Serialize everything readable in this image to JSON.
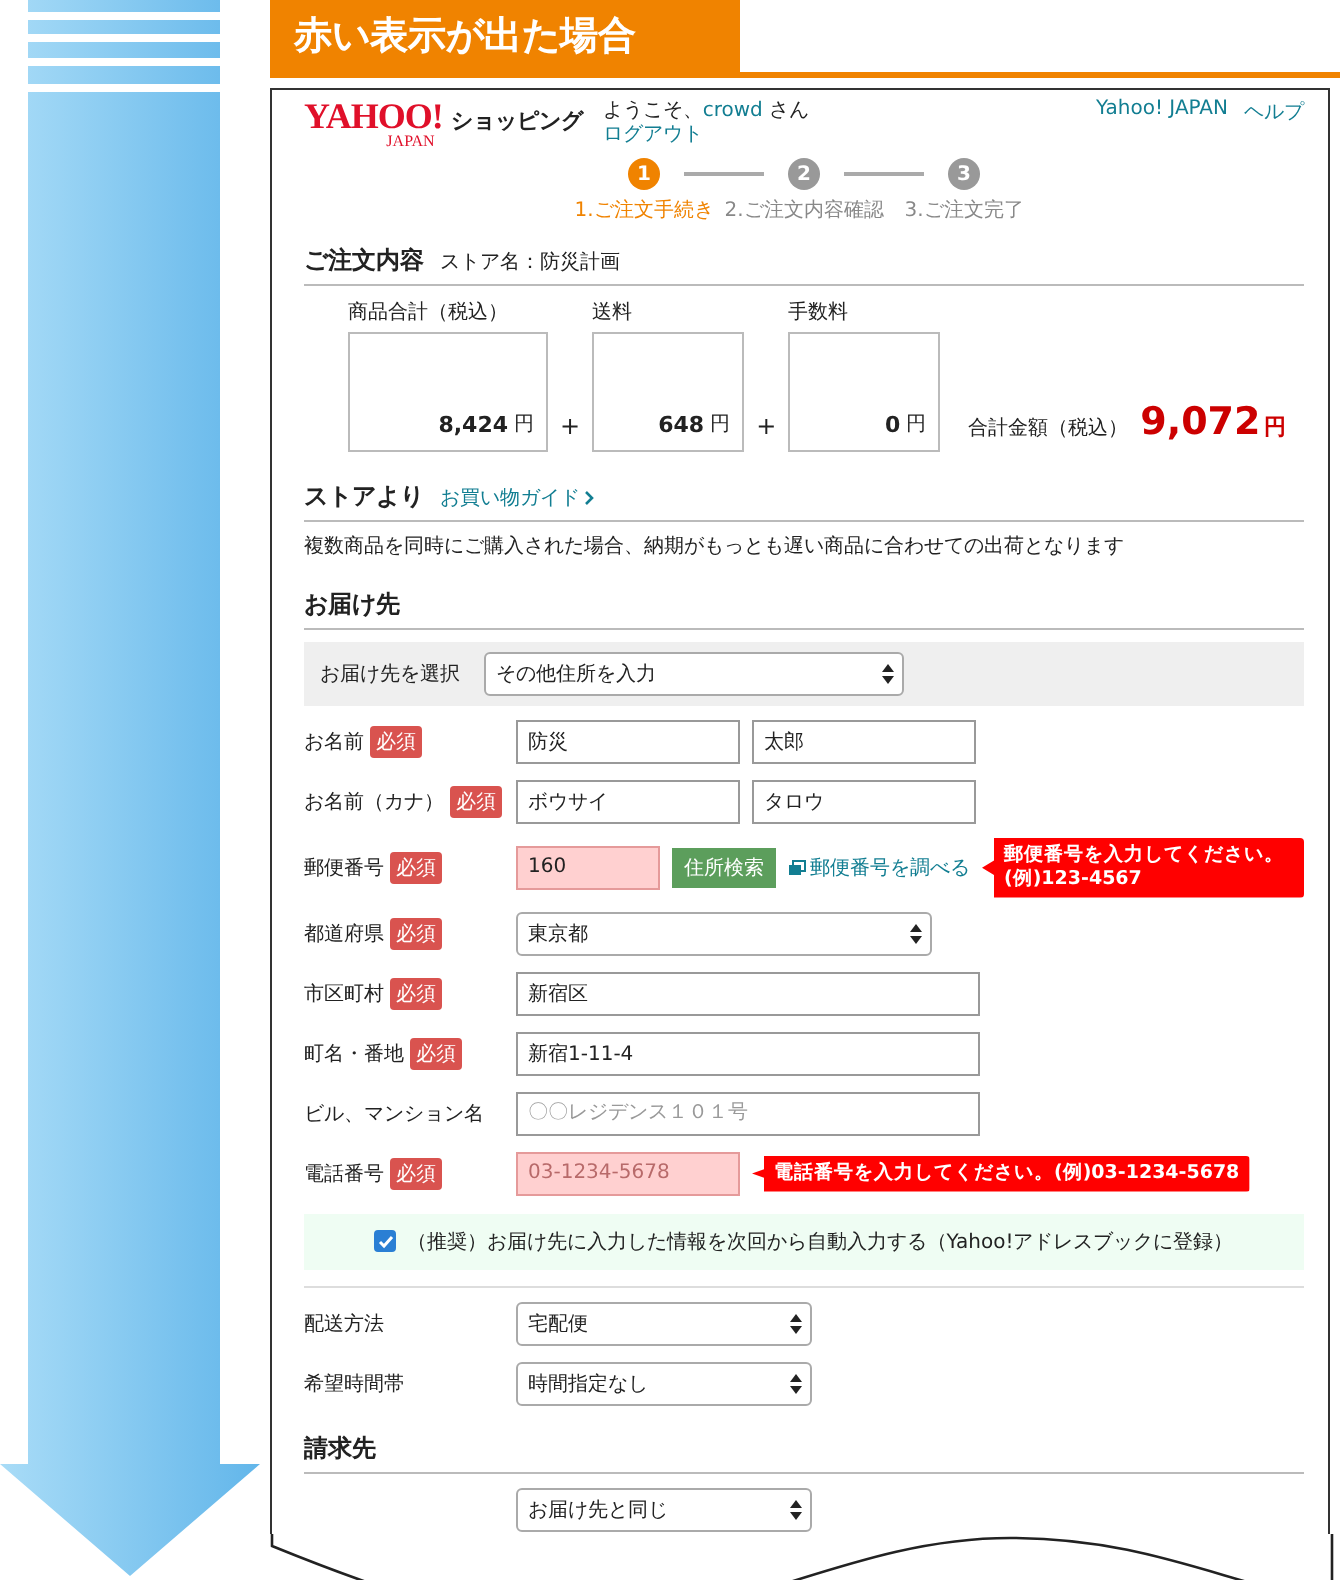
{
  "banner": {
    "title": "赤い表示が出た場合"
  },
  "header": {
    "logo": "YAHOO!",
    "logo_sub": "JAPAN",
    "service": "ショッピング",
    "greeting": "ようこそ、",
    "user": "crowd",
    "honorific": "さん",
    "logout": "ログアウト",
    "links": [
      "Yahoo! JAPAN",
      "ヘルプ"
    ]
  },
  "steps": [
    {
      "number": "1",
      "label": "1.ご注文手続き",
      "selected": true
    },
    {
      "number": "2",
      "label": "2.ご注文内容確認",
      "selected": false
    },
    {
      "number": "3",
      "label": "3.ご注文完了",
      "selected": false
    }
  ],
  "order": {
    "heading": "ご注文内容",
    "store": "ストア名：防災計画",
    "items": [
      {
        "label": "商品合計（税込）",
        "amount": "8,424",
        "unit": "円"
      },
      {
        "label": "送料",
        "amount": "648",
        "unit": "円"
      },
      {
        "label": "手数料",
        "amount": "0",
        "unit": "円"
      }
    ],
    "operators": [
      "+",
      "+"
    ],
    "total_label": "合計金額（税込）",
    "total": "9,072",
    "total_unit": "円"
  },
  "store_notice": {
    "heading": "ストアより",
    "link": "お買い物ガイド",
    "text": "複数商品を同時にご購入された場合、納期がもっとも遅い商品に合わせての出荷となります"
  },
  "delivery": {
    "heading": "お届け先",
    "selector": {
      "label": "お届け先を選択",
      "value": "その他住所を入力"
    },
    "rows": [
      {
        "kind": "name",
        "label": "お名前",
        "badge": "必須",
        "fields": [
          {
            "value": "防災",
            "invalid": false
          },
          {
            "value": "太郎",
            "invalid": false
          }
        ]
      },
      {
        "kind": "name",
        "label": "お名前（カナ）",
        "badge": "必須",
        "fields": [
          {
            "value": "ボウサイ",
            "invalid": false
          },
          {
            "value": "タロウ",
            "invalid": false
          }
        ]
      },
      {
        "kind": "zip",
        "label": "郵便番号",
        "badge": "必須",
        "fields": [
          {
            "value": "160",
            "invalid": true
          }
        ],
        "button": "住所検索",
        "link": "郵便番号を調べる",
        "error": "郵便番号を入力してください。(例)123-4567"
      },
      {
        "kind": "select",
        "label": "都道府県",
        "badge": "必須",
        "fields": [
          {
            "value": "東京都"
          }
        ]
      },
      {
        "kind": "text",
        "label": "市区町村",
        "badge": "必須",
        "fields": [
          {
            "value": "新宿区",
            "invalid": false
          }
        ]
      },
      {
        "kind": "text",
        "label": "町名・番地",
        "badge": "必須",
        "fields": [
          {
            "value": "新宿1-11-4",
            "invalid": false
          }
        ]
      },
      {
        "kind": "text",
        "label": "ビル、マンション名",
        "fields": [
          {
            "placeholder": "〇〇レジデンス１０１号",
            "invalid": false
          }
        ]
      },
      {
        "kind": "phone",
        "label": "電話番号",
        "badge": "必須",
        "fields": [
          {
            "placeholder": "03-1234-5678",
            "invalid": true
          }
        ],
        "error": "電話番号を入力してください。(例)03-1234-5678"
      }
    ],
    "save_option": {
      "checked": true,
      "label": "（推奨）お届け先に入力した情報を次回から自動入力する（Yahoo!アドレスブックに登録）"
    }
  },
  "shipping": [
    {
      "label": "配送方法",
      "value": "宅配便"
    },
    {
      "label": "希望時間帯",
      "value": "時間指定なし"
    }
  ],
  "billing": {
    "heading": "請求先",
    "value": "お届け先と同じ"
  }
}
